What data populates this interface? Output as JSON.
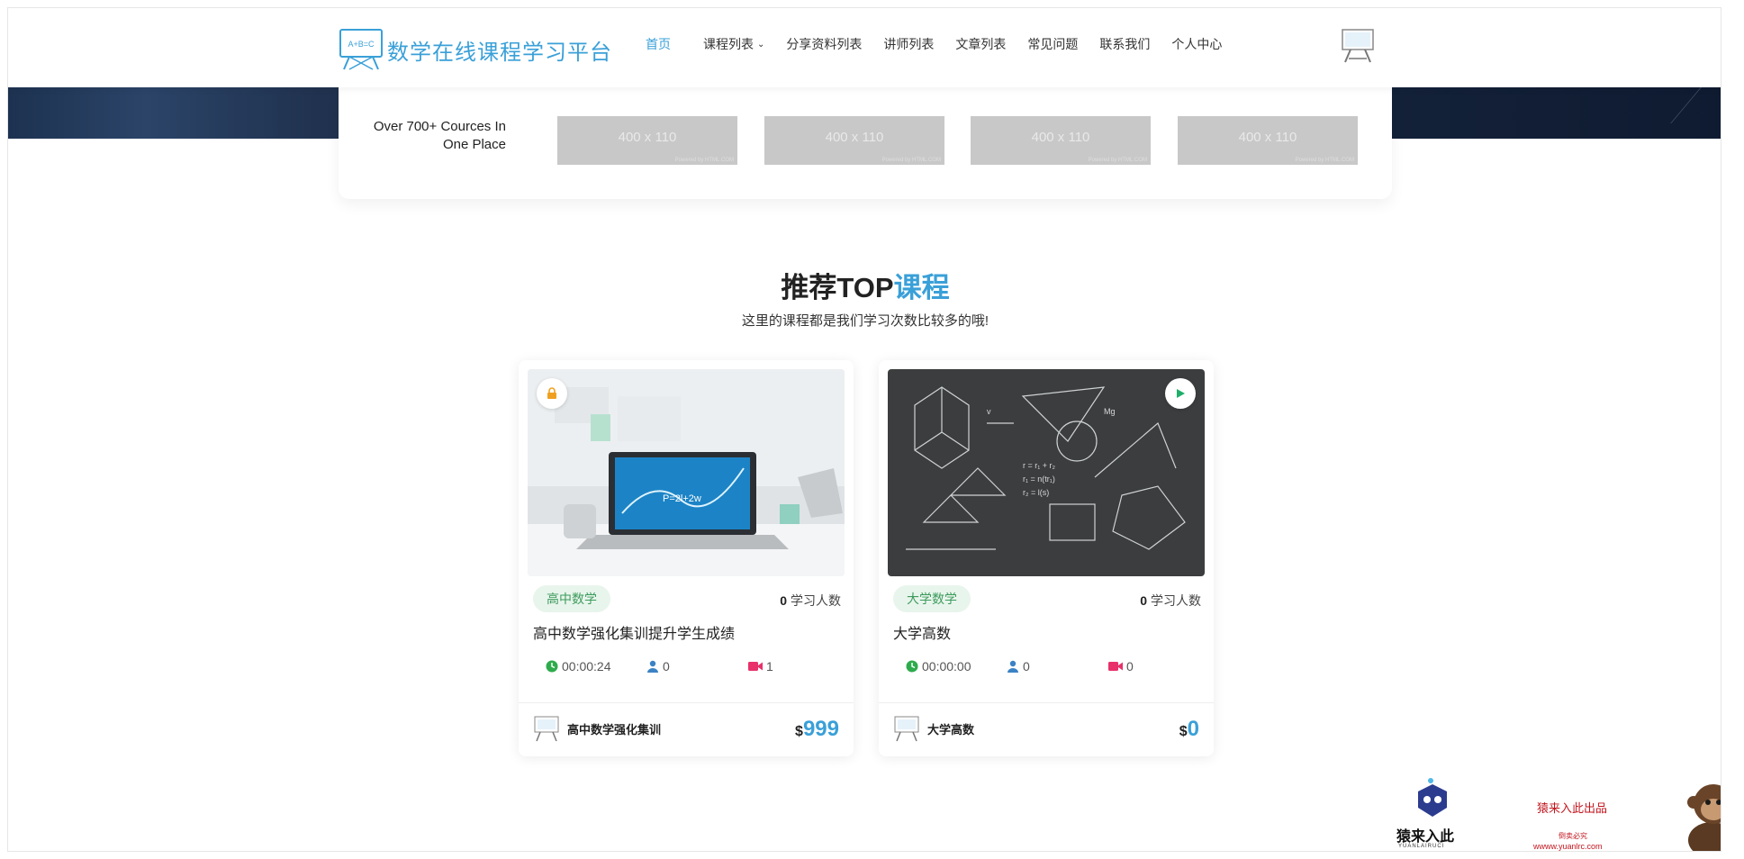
{
  "header": {
    "logo_text": "数学在线课程学习平台",
    "logo_mark": "A+B=C",
    "nav": [
      {
        "label": "首页",
        "active": true
      },
      {
        "label": "课程列表",
        "dropdown": true
      },
      {
        "label": "分享资料列表"
      },
      {
        "label": "讲师列表"
      },
      {
        "label": "文章列表"
      },
      {
        "label": "常见问题"
      },
      {
        "label": "联系我们"
      },
      {
        "label": "个人中心"
      }
    ]
  },
  "sponsors": {
    "title": "Over 700+ Cources In One Place",
    "placeholders": [
      {
        "label": "400 x 110",
        "powered": "Powered by HTML.COM"
      },
      {
        "label": "400 x 110",
        "powered": "Powered by HTML.COM"
      },
      {
        "label": "400 x 110",
        "powered": "Powered by HTML.COM"
      },
      {
        "label": "400 x 110",
        "powered": "Powered by HTML.COM"
      }
    ]
  },
  "section": {
    "title_main": "推荐TOP",
    "title_accent": "课程",
    "subtitle": "这里的课程都是我们学习次数比较多的哦!"
  },
  "courses": [
    {
      "category": "高中数学",
      "learners": "0",
      "learners_label": "学习人数",
      "title": "高中数学强化集训提升学生成绩",
      "duration": "00:00:24",
      "users": "0",
      "videos": "1",
      "author": "高中数学强化集训",
      "price_symbol": "$",
      "price": "999",
      "badge": "lock-icon"
    },
    {
      "category": "大学数学",
      "learners": "0",
      "learners_label": "学习人数",
      "title": "大学高数",
      "duration": "00:00:00",
      "users": "0",
      "videos": "0",
      "author": "大学高数",
      "price_symbol": "$",
      "price": "0",
      "badge": "play-icon"
    }
  ],
  "watermark": {
    "brand": "猿来入此",
    "brand_sub": "YUANLAIRUCI",
    "title": "猿来入此出品",
    "note": "倒卖必究",
    "url": "wwww.yuanlrc.com"
  },
  "colors": {
    "accent": "#3aa0d8",
    "category_bg": "#e8f5ec",
    "category_text": "#3d9b5c",
    "clock": "#2eab4c",
    "user": "#3b82c4",
    "video": "#e8306a",
    "watermark": "#c2161e"
  }
}
